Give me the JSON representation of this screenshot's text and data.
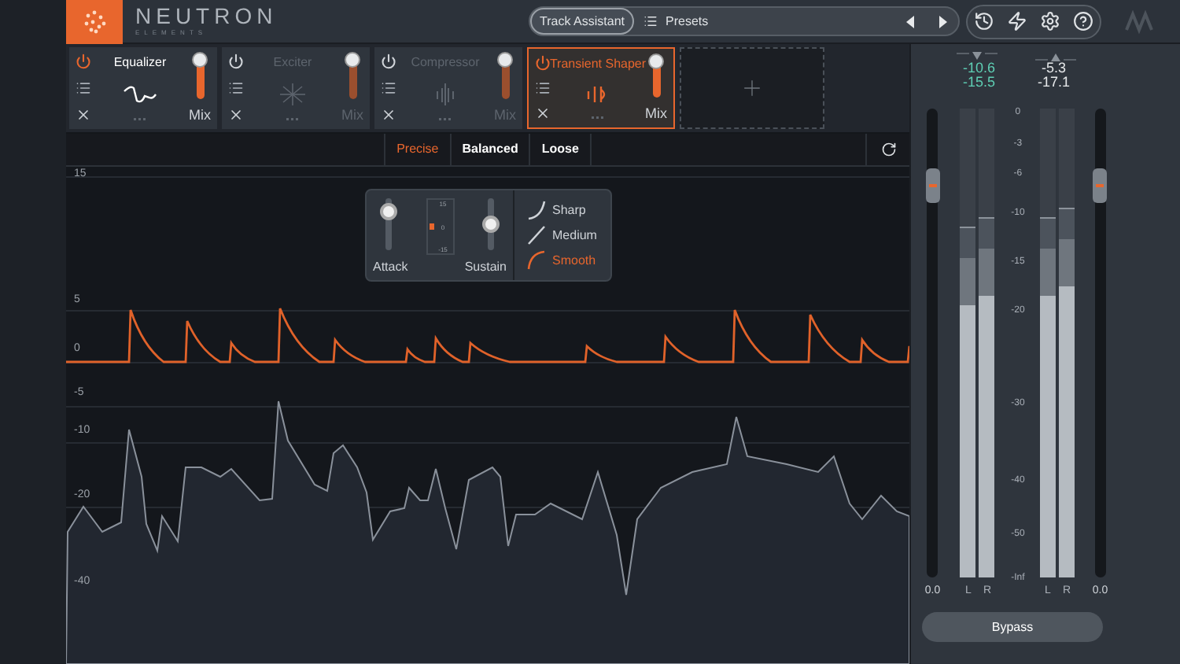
{
  "app": {
    "name": "NEUTRON",
    "subtitle": "ELEMENTS"
  },
  "header": {
    "track_assistant": "Track Assistant",
    "presets": "Presets"
  },
  "modules": [
    {
      "name": "Equalizer",
      "kind": "eq",
      "enabled": true,
      "selected": false,
      "mix_label": "Mix",
      "level": 1
    },
    {
      "name": "Exciter",
      "kind": "exciter",
      "enabled": false,
      "selected": false,
      "mix_label": "Mix",
      "level": 1
    },
    {
      "name": "Compressor",
      "kind": "compressor",
      "enabled": false,
      "selected": false,
      "mix_label": "Mix",
      "level": 1
    },
    {
      "name": "Transient Shaper",
      "kind": "transient",
      "enabled": true,
      "selected": true,
      "mix_label": "Mix",
      "level": 1
    }
  ],
  "modes": [
    {
      "label": "Precise",
      "selected": true
    },
    {
      "label": "Balanced",
      "selected": false
    },
    {
      "label": "Loose",
      "selected": false
    }
  ],
  "graph": {
    "y_labels": [
      "15",
      "5",
      "0",
      "-5",
      "-10",
      "-20",
      "-40"
    ]
  },
  "popup": {
    "attack": {
      "label": "Attack",
      "level": 0.75
    },
    "scale": [
      "15",
      "0",
      "-15"
    ],
    "sustain": {
      "label": "Sustain",
      "level": 0.5
    },
    "shapes": [
      {
        "label": "Sharp",
        "kind": "sharp",
        "selected": false
      },
      {
        "label": "Medium",
        "kind": "medium",
        "selected": false
      },
      {
        "label": "Smooth",
        "kind": "smooth",
        "selected": true
      }
    ]
  },
  "meters": {
    "input": {
      "readings": [
        "-10.6",
        "-15.5"
      ],
      "value": "0.0",
      "channels": [
        {
          "label": "L",
          "level": 0.58
        },
        {
          "label": "R",
          "level": 0.6
        }
      ]
    },
    "output": {
      "readings": [
        "-5.3",
        "-17.1"
      ],
      "value": "0.0",
      "channels": [
        {
          "label": "L",
          "level": 0.6
        },
        {
          "label": "R",
          "level": 0.62
        }
      ]
    },
    "scale": [
      "0",
      "-3",
      "-6",
      "-10",
      "-15",
      "-20",
      "-30",
      "-40",
      "-50",
      "-Inf"
    ],
    "bypass": "Bypass"
  }
}
